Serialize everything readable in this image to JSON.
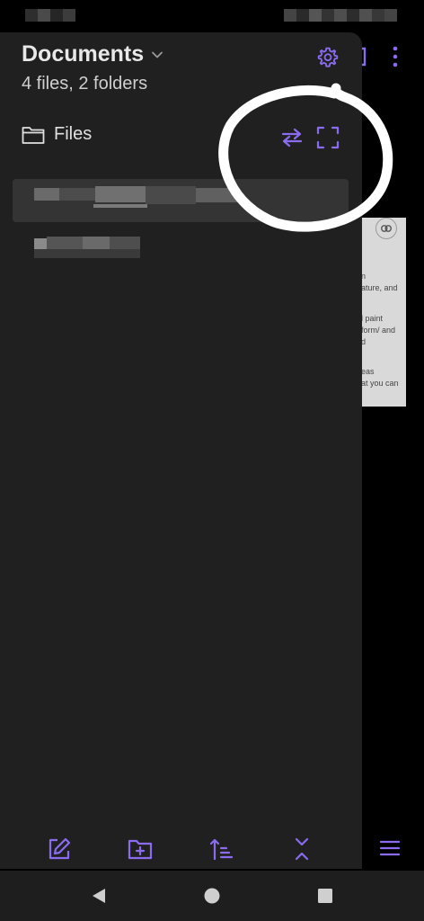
{
  "drawer": {
    "title": "Documents",
    "subtitle": "4 files, 2 folders",
    "section_label": "Files"
  },
  "background_doc": {
    "lines": [
      "n",
      "ature, and",
      "l paint",
      "form/ and",
      "d",
      "eas",
      "at you can"
    ]
  },
  "colors": {
    "accent": "#8b6cf0",
    "drawer_bg": "#202020",
    "selected_row": "#343434",
    "text_primary": "#e8e8e8",
    "text_secondary": "#cfcfcf",
    "nav_bar": "#1e1e1e"
  },
  "icons": {
    "title_chevron": "chevron-down-icon",
    "settings": "gear-icon",
    "folder": "folder-icon",
    "swap": "swap-arrows-icon",
    "expand": "expand-frame-icon",
    "new_note": "edit-note-icon",
    "new_folder": "folder-plus-icon",
    "sort": "sort-icon",
    "collapse": "collapse-icon",
    "menu": "menu-icon",
    "back": "back-triangle-icon",
    "home": "home-circle-icon",
    "recents": "recents-square-icon"
  }
}
